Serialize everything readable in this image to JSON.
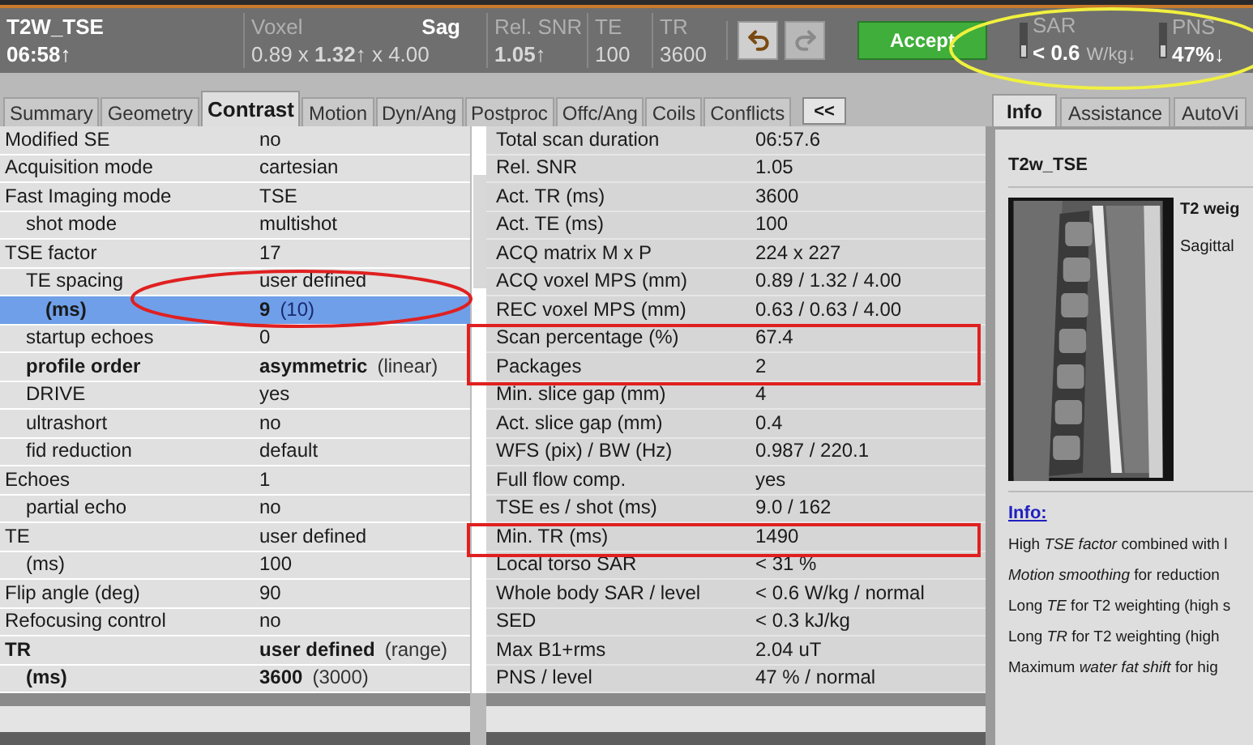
{
  "header": {
    "protocol": "T2W_TSE",
    "duration": "06:58↑",
    "fields": [
      {
        "label": "Voxel",
        "extra": "Sag",
        "value": "0.89 x **1.32↑** x 4.00"
      },
      {
        "label": "Rel. SNR",
        "value": "**1.05↑**"
      },
      {
        "label": "TE",
        "value": "100"
      },
      {
        "label": "TR",
        "value": "3600"
      }
    ],
    "accept": "Accept",
    "sar": {
      "label": "SAR",
      "value": "< 0.6",
      "unit": "W/kg↓"
    },
    "pns": {
      "label": "PNS",
      "value": "47%↓"
    }
  },
  "tabs": [
    {
      "label": "Summary",
      "selected": false
    },
    {
      "label": "Geometry",
      "selected": false
    },
    {
      "label": "Contrast",
      "selected": true
    },
    {
      "label": "Motion",
      "selected": false
    },
    {
      "label": "Dyn/Ang",
      "selected": false
    },
    {
      "label": "Postproc",
      "selected": false
    },
    {
      "label": "Offc/Ang",
      "selected": false
    },
    {
      "label": "Coils",
      "selected": false
    },
    {
      "label": "Conflicts",
      "selected": false
    }
  ],
  "collapse_button": "<<",
  "parameters": [
    {
      "label": "Modified SE",
      "value": "no",
      "changed": false,
      "selected": false
    },
    {
      "label": "Acquisition mode",
      "value": "cartesian",
      "changed": false,
      "selected": false
    },
    {
      "label": "Fast Imaging mode",
      "value": "TSE",
      "changed": false,
      "selected": false,
      "children": [
        {
          "label": "shot mode",
          "value": "multishot",
          "changed": false,
          "selected": false
        }
      ]
    },
    {
      "label": "TSE factor",
      "value": "17",
      "changed": false,
      "selected": false,
      "children": [
        {
          "label": "TE spacing",
          "value": "user defined",
          "changed": false,
          "selected": false,
          "children": [
            {
              "label": "(ms)",
              "value": "9",
              "default": "(10)",
              "changed": true,
              "selected": true
            }
          ]
        },
        {
          "label": "startup echoes",
          "value": "0",
          "changed": false,
          "selected": false
        },
        {
          "label": "profile order",
          "value": "asymmetric",
          "default": "(linear)",
          "changed": true,
          "selected": false
        },
        {
          "label": "DRIVE",
          "value": "yes",
          "changed": false,
          "selected": false
        },
        {
          "label": "ultrashort",
          "value": "no",
          "changed": false,
          "selected": false
        },
        {
          "label": "fid reduction",
          "value": "default",
          "changed": false,
          "selected": false
        }
      ]
    },
    {
      "label": "Echoes",
      "value": "1",
      "changed": false,
      "selected": false,
      "children": [
        {
          "label": "partial echo",
          "value": "no",
          "changed": false,
          "selected": false
        }
      ]
    },
    {
      "label": "TE",
      "value": "user defined",
      "changed": false,
      "selected": false,
      "children": [
        {
          "label": "(ms)",
          "value": "100",
          "changed": false,
          "selected": false
        }
      ]
    },
    {
      "label": "Flip angle (deg)",
      "value": "90",
      "changed": false,
      "selected": false
    },
    {
      "label": "Refocusing control",
      "value": "no",
      "changed": false,
      "selected": false
    },
    {
      "label": "TR",
      "value": "user defined",
      "default": "(range)",
      "changed": true,
      "selected": false,
      "children": [
        {
          "label": "(ms)",
          "value": "3600",
          "default": "(3000)",
          "changed": true,
          "selected": false
        }
      ]
    }
  ],
  "results": [
    {
      "label": "Total scan duration",
      "value": "06:57.6"
    },
    {
      "label": "Rel. SNR",
      "value": "1.05"
    },
    {
      "label": "Act. TR (ms)",
      "value": "3600"
    },
    {
      "label": "Act. TE (ms)",
      "value": "100"
    },
    {
      "label": "ACQ matrix M x P",
      "value": "224 x 227"
    },
    {
      "label": "ACQ voxel MPS (mm)",
      "value": "0.89 / 1.32 / 4.00"
    },
    {
      "label": "REC voxel MPS (mm)",
      "value": "0.63 / 0.63 / 4.00"
    },
    {
      "label": "Scan percentage (%)",
      "value": "67.4"
    },
    {
      "label": "Packages",
      "value": "2"
    },
    {
      "label": "Min. slice gap (mm)",
      "value": "4"
    },
    {
      "label": "Act. slice gap (mm)",
      "value": "0.4"
    },
    {
      "label": "WFS (pix) / BW (Hz)",
      "value": "0.987 / 220.1"
    },
    {
      "label": "Full flow comp.",
      "value": "yes"
    },
    {
      "label": "TSE es / shot (ms)",
      "value": "9.0 / 162"
    },
    {
      "label": "Min. TR (ms)",
      "value": "1490"
    },
    {
      "label": "Local torso SAR",
      "value": "< 31 %"
    },
    {
      "label": "Whole body SAR / level",
      "value": "< 0.6 W/kg / normal"
    },
    {
      "label": "SED",
      "value": "< 0.3 kJ/kg"
    },
    {
      "label": "Max B1+rms",
      "value": "2.04 uT"
    },
    {
      "label": "PNS / level",
      "value": "47 % / normal"
    }
  ],
  "info_tabs": [
    {
      "label": "Info",
      "selected": true
    },
    {
      "label": "Assistance",
      "selected": false
    },
    {
      "label": "AutoVi",
      "selected": false
    }
  ],
  "info": {
    "title": "T2w_TSE",
    "image": {
      "kind": "picture"
    },
    "image_title": "T2 weig",
    "image_caption": "Sagittal",
    "link": "Info:",
    "lines": [
      "High *TSE factor* combined with l",
      "*Motion smoothing* for reduction",
      "Long *TE* for T2 weighting (high s",
      "Long *TR* for T2 weighting (high",
      "Maximum *water fat shift* for hig"
    ]
  },
  "annotations": [
    {
      "kind": "ellipse",
      "color": "#e02020"
    },
    {
      "kind": "rectangle",
      "color": "#e02020"
    },
    {
      "kind": "rectangle",
      "color": "#e02020"
    },
    {
      "kind": "ellipse",
      "color": "#f0f040"
    }
  ]
}
